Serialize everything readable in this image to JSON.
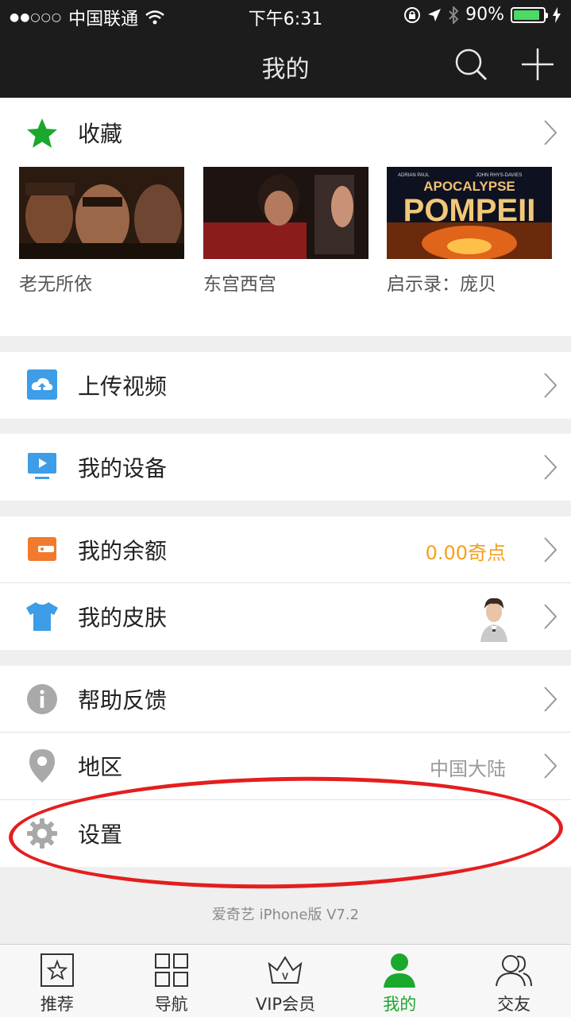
{
  "status_bar": {
    "signal": "●●○○○",
    "carrier": "中国联通",
    "time": "下午6:31",
    "battery": "90%",
    "battery_level": 0.9
  },
  "header": {
    "title": "我的",
    "search_icon": "search-icon",
    "add_icon": "plus-icon"
  },
  "favorites": {
    "label": "收藏",
    "items": [
      {
        "title": "老无所依"
      },
      {
        "title": "东宫西宫"
      },
      {
        "title": "启示录：庞贝",
        "poster_top_left": "ADRIAN PAUL",
        "poster_top_right": "JOHN RHYS-DAVIES",
        "poster_line1": "APOCALYPSE",
        "poster_line2": "POMPEII"
      }
    ]
  },
  "menu": {
    "upload": {
      "label": "上传视频",
      "icon": "cloud-upload-icon"
    },
    "devices": {
      "label": "我的设备",
      "icon": "tv-icon"
    },
    "balance": {
      "label": "我的余额",
      "value": "0.00奇点",
      "icon": "wallet-icon"
    },
    "skin": {
      "label": "我的皮肤",
      "icon": "tshirt-icon"
    },
    "help": {
      "label": "帮助反馈",
      "icon": "info-icon"
    },
    "region": {
      "label": "地区",
      "value": "中国大陆",
      "icon": "location-pin-icon"
    },
    "settings": {
      "label": "设置",
      "icon": "gear-icon"
    }
  },
  "version": "爱奇艺 iPhone版 V7.2",
  "tabs": [
    {
      "label": "推荐",
      "icon": "star-box-icon",
      "active": false
    },
    {
      "label": "导航",
      "icon": "grid-icon",
      "active": false
    },
    {
      "label": "VIP会员",
      "icon": "crown-icon",
      "active": false
    },
    {
      "label": "我的",
      "icon": "user-icon",
      "active": true
    },
    {
      "label": "交友",
      "icon": "friends-icon",
      "active": false
    }
  ],
  "colors": {
    "accent_green": "#1aa82d",
    "balance_orange": "#f5a01c",
    "annotation_red": "#e41e1e"
  }
}
